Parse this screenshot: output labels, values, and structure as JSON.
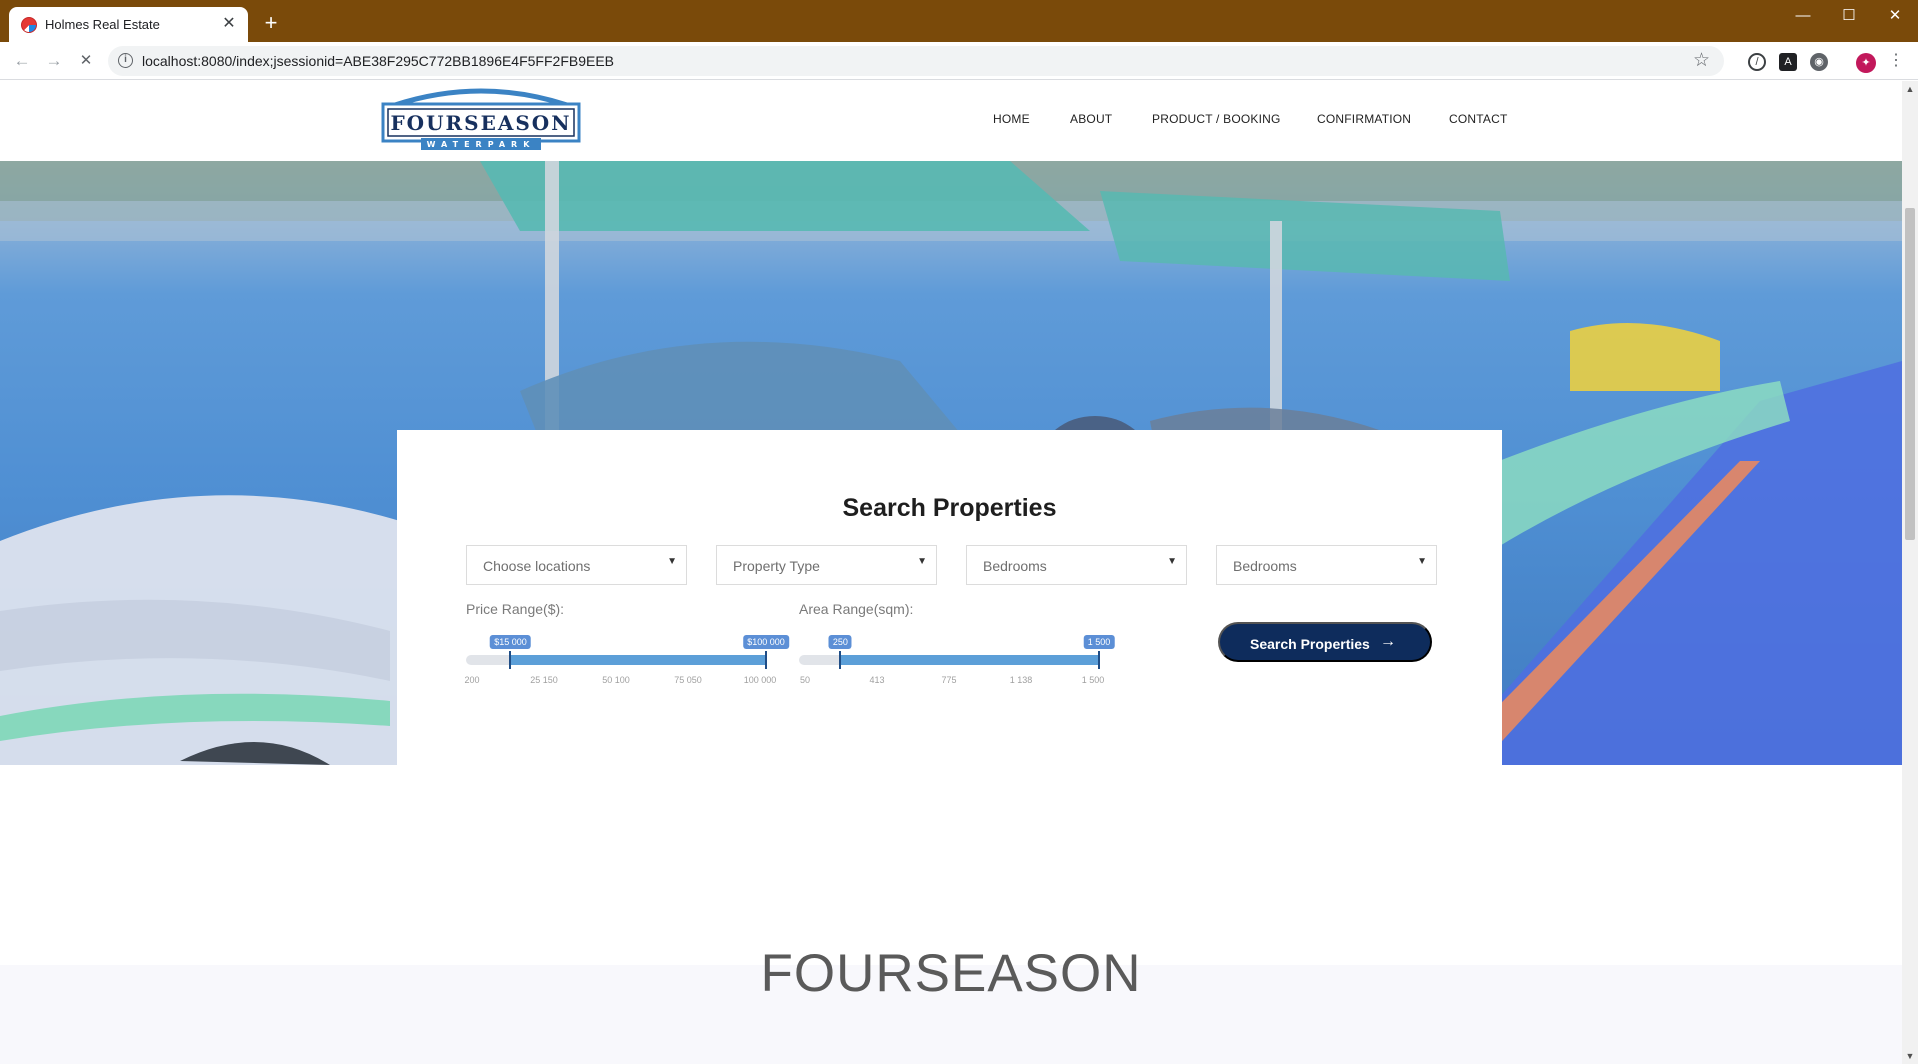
{
  "browser": {
    "tab_title": "Holmes Real Estate",
    "tab_close": "✕",
    "new_tab": "+",
    "url": "localhost:8080/index;jsessionid=ABE38F295C772BB1896E4F5FF2FB9EEB",
    "window_controls": {
      "minimize": "—",
      "maximize": "☐",
      "close": "✕"
    }
  },
  "site": {
    "logo": {
      "name": "FOURSEASON",
      "sub": "WATERPARK"
    },
    "nav": [
      "HOME",
      "ABOUT",
      "PRODUCT / BOOKING",
      "CONFIRMATION",
      "CONTACT"
    ]
  },
  "search": {
    "title": "Search Properties",
    "selects": [
      "Choose locations",
      "Property Type",
      "Bedrooms",
      "Bedrooms"
    ],
    "price_range": {
      "label": "Price Range($):",
      "low": "$15 000",
      "high": "$100 000",
      "ticks": [
        "200",
        "25 150",
        "50 100",
        "75 050",
        "100 000"
      ],
      "min": 200,
      "max": 100000,
      "from": 15000,
      "to": 100000
    },
    "area_range": {
      "label": "Area Range(sqm):",
      "low": "250",
      "high": "1 500",
      "ticks": [
        "50",
        "413",
        "775",
        "1 138",
        "1 500"
      ],
      "min": 50,
      "max": 1500,
      "from": 250,
      "to": 1500
    },
    "button_label": "Search Properties",
    "button_arrow": "→"
  },
  "section_heading": "FOURSEASON",
  "colors": {
    "chrome_frame": "#7a4a0a",
    "button_navy": "#0e2c5c",
    "slider_fill": "#5c9fd8",
    "logo_navy": "#17305e",
    "logo_blue": "#3b83c4"
  }
}
